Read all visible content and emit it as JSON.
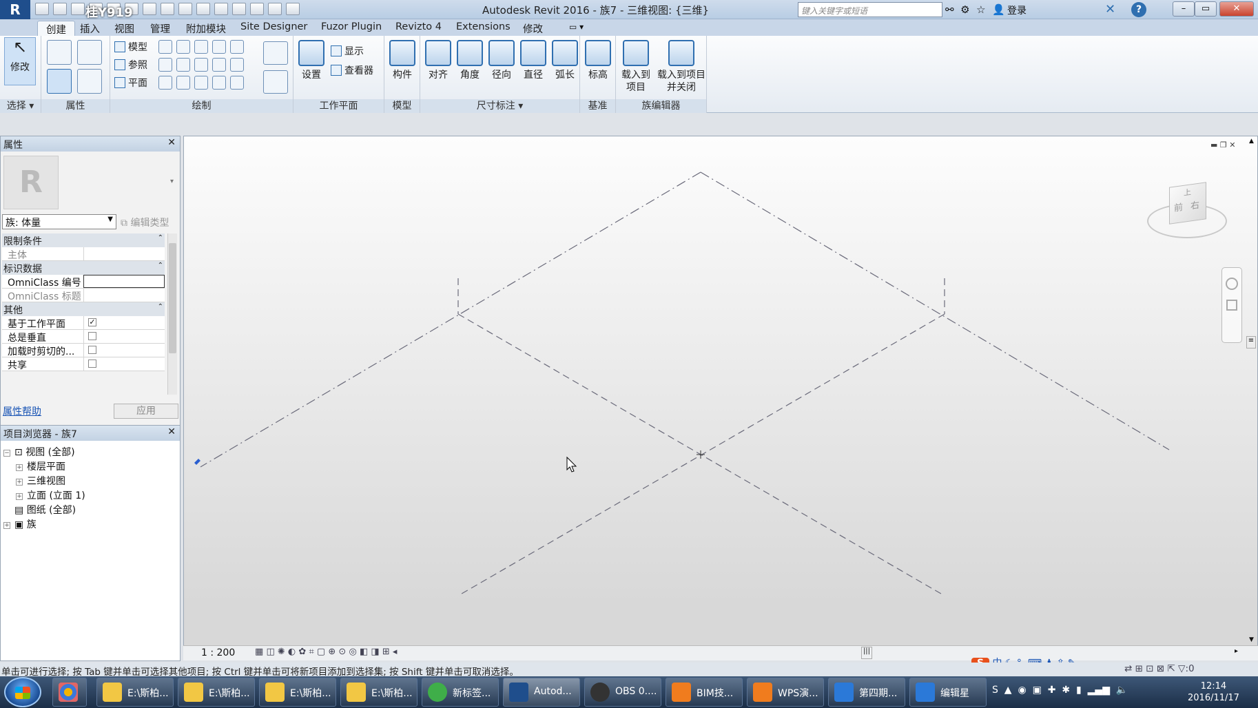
{
  "app": {
    "title": "Autodesk Revit 2016 -    族7 - 三维视图: {三维}",
    "logo": "R",
    "watermark": "桂Y919"
  },
  "search": {
    "placeholder": "键入关键字或短语"
  },
  "account": {
    "login": "登录",
    "help": "?"
  },
  "tabs": [
    "创建",
    "插入",
    "视图",
    "管理",
    "附加模块",
    "Site Designer",
    "Fuzor Plugin",
    "Revizto 4",
    "Extensions",
    "修改"
  ],
  "ribbon": {
    "select": {
      "modify": "修改",
      "panel": "选择 ▾"
    },
    "properties": {
      "panel": "属性"
    },
    "draw": {
      "model": "模型",
      "reference": "参照",
      "plane": "平面",
      "panel": "绘制"
    },
    "workplane": {
      "set": "设置",
      "show": "显示",
      "viewer": "查看器",
      "panel": "工作平面"
    },
    "model": {
      "component": "构件",
      "panel": "模型"
    },
    "dimension": {
      "aligned": "对齐",
      "angular": "角度",
      "radial": "径向",
      "diameter": "直径",
      "arc": "弧长",
      "panel": "尺寸标注 ▾"
    },
    "datum": {
      "level": "标高",
      "panel": "基准"
    },
    "family_editor": {
      "load_project": "载入到项目",
      "load_close": "载入到项目并关闭",
      "panel": "族编辑器"
    }
  },
  "properties_panel": {
    "title": "属性",
    "family_select": "族: 体量",
    "edit_type": "编辑类型",
    "groups": {
      "constraints": "限制条件",
      "identity": "标识数据",
      "other": "其他"
    },
    "rows": {
      "host": "主体",
      "omniclass_number": "OmniClass 编号",
      "omniclass_title": "OmniClass 标题",
      "workplane_based": "基于工作平面",
      "always_vertical": "总是垂直",
      "cut_on_load": "加载时剪切的...",
      "shared": "共享"
    },
    "checks": {
      "workplane_based": true,
      "always_vertical": false,
      "cut_on_load": false,
      "shared": false
    },
    "help_link": "属性帮助",
    "apply": "应用"
  },
  "project_browser": {
    "title": "项目浏览器 - 族7",
    "items": [
      "视图 (全部)",
      "楼层平面",
      "三维视图",
      "立面 (立面 1)",
      "图纸 (全部)",
      "族"
    ]
  },
  "viewcube": {
    "front": "前",
    "right": "右",
    "top": "上"
  },
  "view_control": {
    "scale": "1 : 200"
  },
  "status_bar": {
    "text": "单击可进行选择; 按 Tab 键并单击可选择其他项目; 按 Ctrl 键并单击可将新项目添加到选择集; 按 Shift 键并单击可取消选择。",
    "filter": ":0"
  },
  "taskbar": {
    "buttons": [
      "E:\\斯柏...",
      "E:\\斯柏...",
      "E:\\斯柏...",
      "E:\\斯柏...",
      "新标签...",
      "Autod...",
      "OBS 0....",
      "BIM技...",
      "WPS演...",
      "第四期...",
      "编辑星"
    ],
    "time": "12:14",
    "date": "2016/11/17",
    "ime": "中"
  },
  "colors": {
    "accent": "#2f6fb0",
    "taskbar": "#1b2e47",
    "ribbon_label": "#d5e0ec"
  }
}
